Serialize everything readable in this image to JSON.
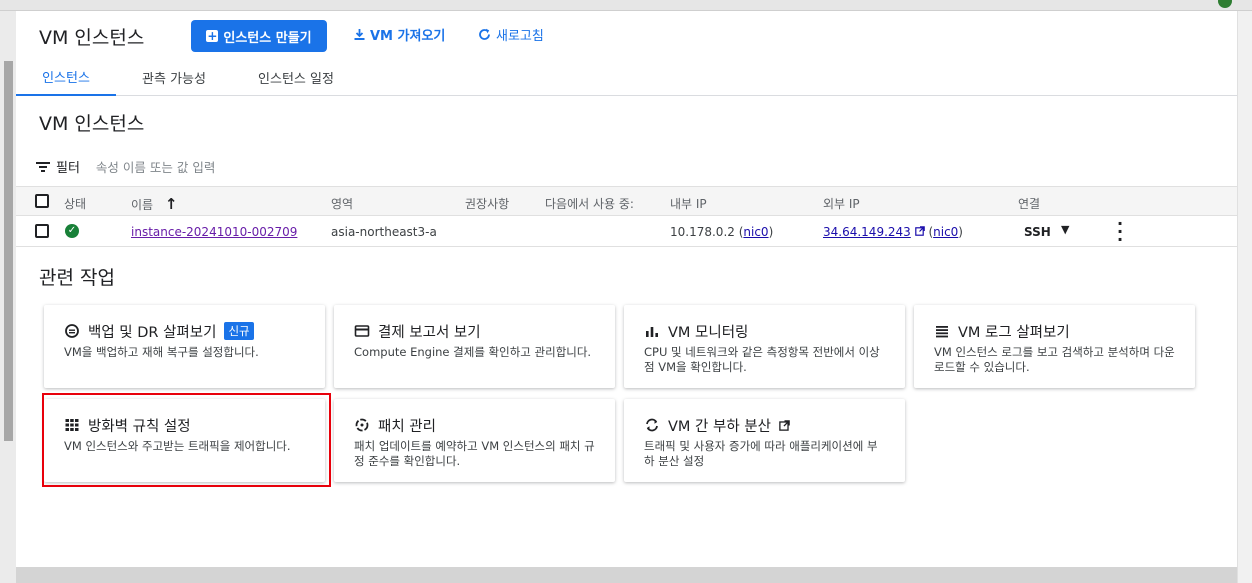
{
  "header": {
    "title": "VM 인스턴스",
    "create_button": "인스턴스 만들기",
    "import_button": "VM 가져오기",
    "refresh_button": "새로고침"
  },
  "tabs": [
    {
      "label": "인스턴스",
      "active": true
    },
    {
      "label": "관측 가능성",
      "active": false
    },
    {
      "label": "인스턴스 일정",
      "active": false
    }
  ],
  "section_title": "VM 인스턴스",
  "filter": {
    "label": "필터",
    "placeholder": "속성 이름 또는 값 입력"
  },
  "table": {
    "columns": {
      "status": "상태",
      "name": "이름",
      "zone": "영역",
      "recommendation": "권장사항",
      "in_use_by": "다음에서 사용 중:",
      "internal_ip": "내부 IP",
      "external_ip": "외부 IP",
      "connect": "연결"
    },
    "rows": [
      {
        "name": "instance-20241010-002709",
        "zone": "asia-northeast3-a",
        "internal_ip": "10.178.0.2",
        "internal_nic": "nic0",
        "external_ip": "34.64.149.243",
        "external_nic": "nic0",
        "connect": "SSH"
      }
    ]
  },
  "related": {
    "title": "관련 작업",
    "cards": [
      {
        "title": "백업 및 DR 살펴보기",
        "badge": "신규",
        "desc": "VM을 백업하고 재해 복구를 설정합니다."
      },
      {
        "title": "결제 보고서 보기",
        "desc": "Compute Engine 결제를 확인하고 관리합니다."
      },
      {
        "title": "VM 모니터링",
        "desc": "CPU 및 네트워크와 같은 측정항목 전반에서 이상점 VM을 확인합니다."
      },
      {
        "title": "VM 로그 살펴보기",
        "desc": "VM 인스턴스 로그를 보고 검색하고 분석하며 다운로드할 수 있습니다."
      },
      {
        "title": "방화벽 규칙 설정",
        "desc": "VM 인스턴스와 주고받는 트래픽을 제어합니다."
      },
      {
        "title": "패치 관리",
        "desc": "패치 업데이트를 예약하고 VM 인스턴스의 패치 규정 준수를 확인합니다."
      },
      {
        "title": "VM 간 부하 분산",
        "desc": "트래픽 및 사용자 증가에 따라 애플리케이션에 부하 분산 설정"
      }
    ]
  },
  "colors": {
    "accent": "#1a73e8",
    "highlight": "#e8000b",
    "status_ok": "#188038"
  }
}
